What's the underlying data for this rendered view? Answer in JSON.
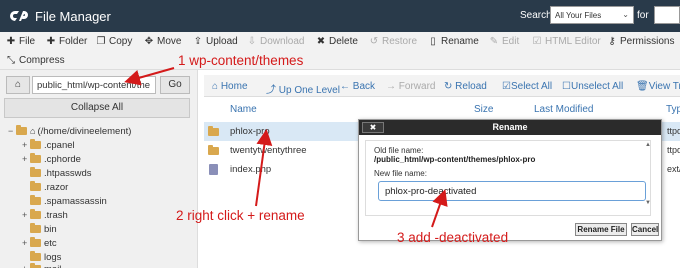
{
  "header": {
    "app_title": "File Manager",
    "search_label": "Search",
    "search_scope": "All Your Files",
    "for_label": "for"
  },
  "toolbar": {
    "items": [
      {
        "label": "File",
        "icon": "plus-icon"
      },
      {
        "label": "Folder",
        "icon": "plus-icon"
      },
      {
        "label": "Copy",
        "icon": "copy-icon"
      },
      {
        "label": "Move",
        "icon": "move-icon"
      },
      {
        "label": "Upload",
        "icon": "upload-icon"
      },
      {
        "label": "Download",
        "icon": "download-icon"
      },
      {
        "label": "Delete",
        "icon": "delete-icon"
      },
      {
        "label": "Restore",
        "icon": "restore-icon"
      },
      {
        "label": "Rename",
        "icon": "rename-icon"
      },
      {
        "label": "Edit",
        "icon": "edit-icon"
      },
      {
        "label": "HTML Editor",
        "icon": "html-editor-icon"
      },
      {
        "label": "Permissions",
        "icon": "key-icon"
      },
      {
        "label": "Compress",
        "icon": "compress-icon"
      }
    ]
  },
  "left_panel": {
    "path_value": "public_html/wp-content/the",
    "go_label": "Go",
    "collapse_label": "Collapse All",
    "tree": [
      {
        "label": "(/home/divineelement)",
        "toggle": "−"
      },
      {
        "label": ".cpanel",
        "toggle": "+"
      },
      {
        "label": ".cphorde",
        "toggle": "+"
      },
      {
        "label": ".htpasswds",
        "toggle": ""
      },
      {
        "label": ".razor",
        "toggle": ""
      },
      {
        "label": ".spamassassin",
        "toggle": ""
      },
      {
        "label": ".trash",
        "toggle": "+"
      },
      {
        "label": "bin",
        "toggle": ""
      },
      {
        "label": "etc",
        "toggle": "+"
      },
      {
        "label": "logs",
        "toggle": ""
      },
      {
        "label": "mail",
        "toggle": "+"
      }
    ]
  },
  "right_panel": {
    "nav": [
      {
        "label": "Home",
        "icon": "home-icon"
      },
      {
        "label": "Up One Level",
        "icon": "up-arrow-icon"
      },
      {
        "label": "Back",
        "icon": "back-arrow-icon"
      },
      {
        "label": "Forward",
        "icon": "forward-arrow-icon"
      },
      {
        "label": "Reload",
        "icon": "reload-icon"
      },
      {
        "label": "Select All",
        "icon": "checkbox-checked-icon"
      },
      {
        "label": "Unselect All",
        "icon": "checkbox-icon"
      },
      {
        "label": "View Tra",
        "icon": "trash-icon"
      }
    ],
    "columns": {
      "name": "Name",
      "size": "Size",
      "last_modified": "Last Modified",
      "type": "Type"
    },
    "files": [
      {
        "name": "phlox-pro",
        "kind": "folder",
        "type_cell": "ttpd"
      },
      {
        "name": "twentytwentythree",
        "kind": "folder",
        "type_cell": "ttpd"
      },
      {
        "name": "index.php",
        "kind": "file",
        "type_cell": "ext/x"
      }
    ]
  },
  "dialog": {
    "title": "Rename",
    "close_label": "✖",
    "old_label": "Old file name:",
    "old_value": "/public_html/wp-content/themes/phlox-pro",
    "new_label": "New file name:",
    "new_value": "phlox-pro-deactivated",
    "rename_button": "Rename File",
    "cancel_button": "Cancel"
  },
  "annotations": {
    "step1": "1 wp-content/themes",
    "step2": "2 right click + rename",
    "step3": "3 add -deactivated",
    "color": "#d41a1a"
  }
}
